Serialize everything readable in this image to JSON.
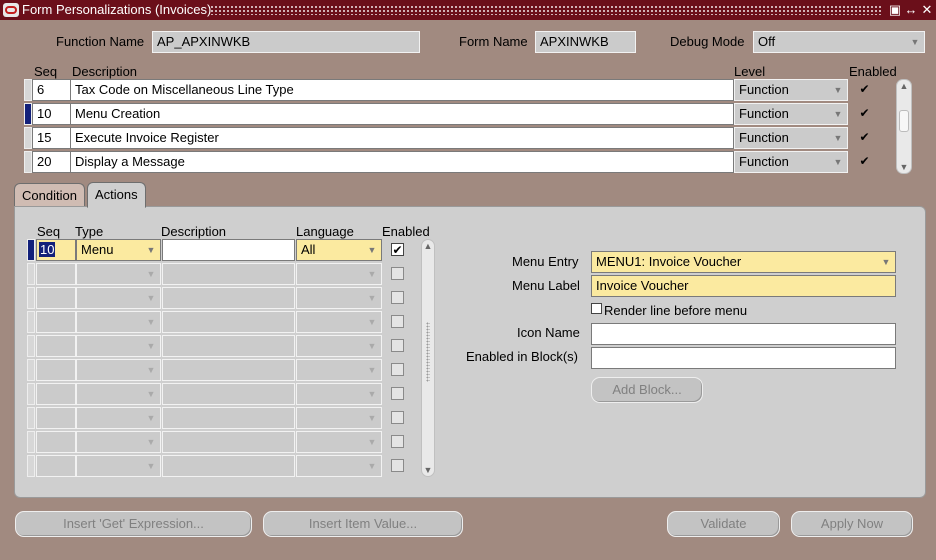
{
  "window": {
    "title": "Form Personalizations (Invoices)",
    "controls": [
      "▣",
      "↔",
      "✕"
    ]
  },
  "header": {
    "function_name_label": "Function Name",
    "function_name_value": "AP_APXINWKB",
    "form_name_label": "Form Name",
    "form_name_value": "APXINWKB",
    "debug_mode_label": "Debug Mode",
    "debug_mode_value": "Off"
  },
  "rules": {
    "headers": {
      "seq": "Seq",
      "description": "Description",
      "level": "Level",
      "enabled": "Enabled"
    },
    "rows": [
      {
        "seq": "6",
        "description": "Tax Code on Miscellaneous Line Type",
        "level": "Function",
        "enabled": "✔"
      },
      {
        "seq": "10",
        "description": "Menu Creation",
        "level": "Function",
        "enabled": "✔"
      },
      {
        "seq": "15",
        "description": "Execute Invoice Register",
        "level": "Function",
        "enabled": "✔"
      },
      {
        "seq": "20",
        "description": "Display a Message",
        "level": "Function",
        "enabled": "✔"
      }
    ]
  },
  "tabs": {
    "condition": "Condition",
    "actions": "Actions"
  },
  "actions": {
    "headers": {
      "seq": "Seq",
      "type": "Type",
      "description": "Description",
      "language": "Language",
      "enabled": "Enabled"
    },
    "first_row": {
      "seq": "10",
      "type": "Menu",
      "description": "",
      "language": "All",
      "enabled": "✔"
    }
  },
  "detail": {
    "menu_entry_label": "Menu Entry",
    "menu_entry_value": "MENU1: Invoice Voucher",
    "menu_label_label": "Menu Label",
    "menu_label_value": "Invoice Voucher",
    "render_line_label": "Render line before menu",
    "icon_name_label": "Icon Name",
    "icon_name_value": "",
    "enabled_blocks_label": "Enabled in Block(s)",
    "enabled_blocks_value": "",
    "add_block_button": "Add Block..."
  },
  "footer": {
    "insert_get_expression": "Insert 'Get' Expression...",
    "insert_item_value": "Insert Item Value...",
    "validate": "Validate",
    "apply_now": "Apply Now"
  }
}
